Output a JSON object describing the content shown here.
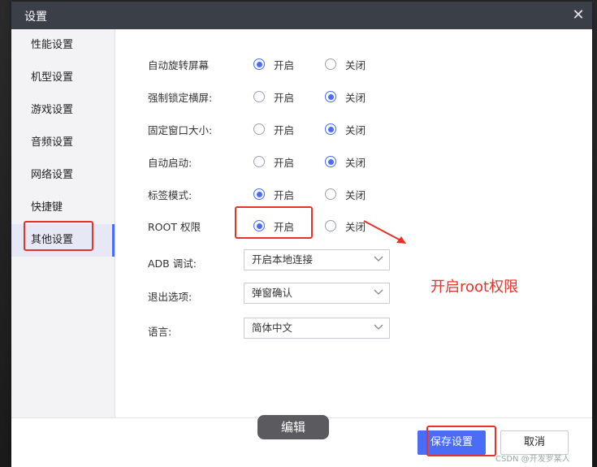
{
  "dialog": {
    "title": "设置"
  },
  "sidebar": {
    "items": [
      {
        "label": "性能设置"
      },
      {
        "label": "机型设置"
      },
      {
        "label": "游戏设置"
      },
      {
        "label": "音频设置"
      },
      {
        "label": "网络设置"
      },
      {
        "label": "快捷键"
      },
      {
        "label": "其他设置"
      }
    ]
  },
  "settings": {
    "option_on": "开启",
    "option_off": "关闭",
    "rows": [
      {
        "label": "自动旋转屏幕",
        "selected": "on"
      },
      {
        "label": "强制锁定横屏:",
        "selected": "off"
      },
      {
        "label": "固定窗口大小:",
        "selected": "off"
      },
      {
        "label": "自动启动:",
        "selected": "off"
      },
      {
        "label": "标签模式:",
        "selected": "on"
      },
      {
        "label": "ROOT 权限",
        "selected": "on"
      }
    ],
    "selects": [
      {
        "label": "ADB 调试:",
        "value": "开启本地连接"
      },
      {
        "label": "退出选项:",
        "value": "弹窗确认"
      },
      {
        "label": "语言:",
        "value": "简体中文"
      }
    ]
  },
  "annotation": {
    "text": "开启root权限"
  },
  "footer": {
    "edit_label": "编辑",
    "save_label": "保存设置",
    "cancel_label": "取消",
    "watermark": "CSDN @开发罗某人"
  },
  "colors": {
    "accent": "#4a6cf7",
    "annotation": "#e5332a",
    "titlebar": "#3b3f48"
  }
}
